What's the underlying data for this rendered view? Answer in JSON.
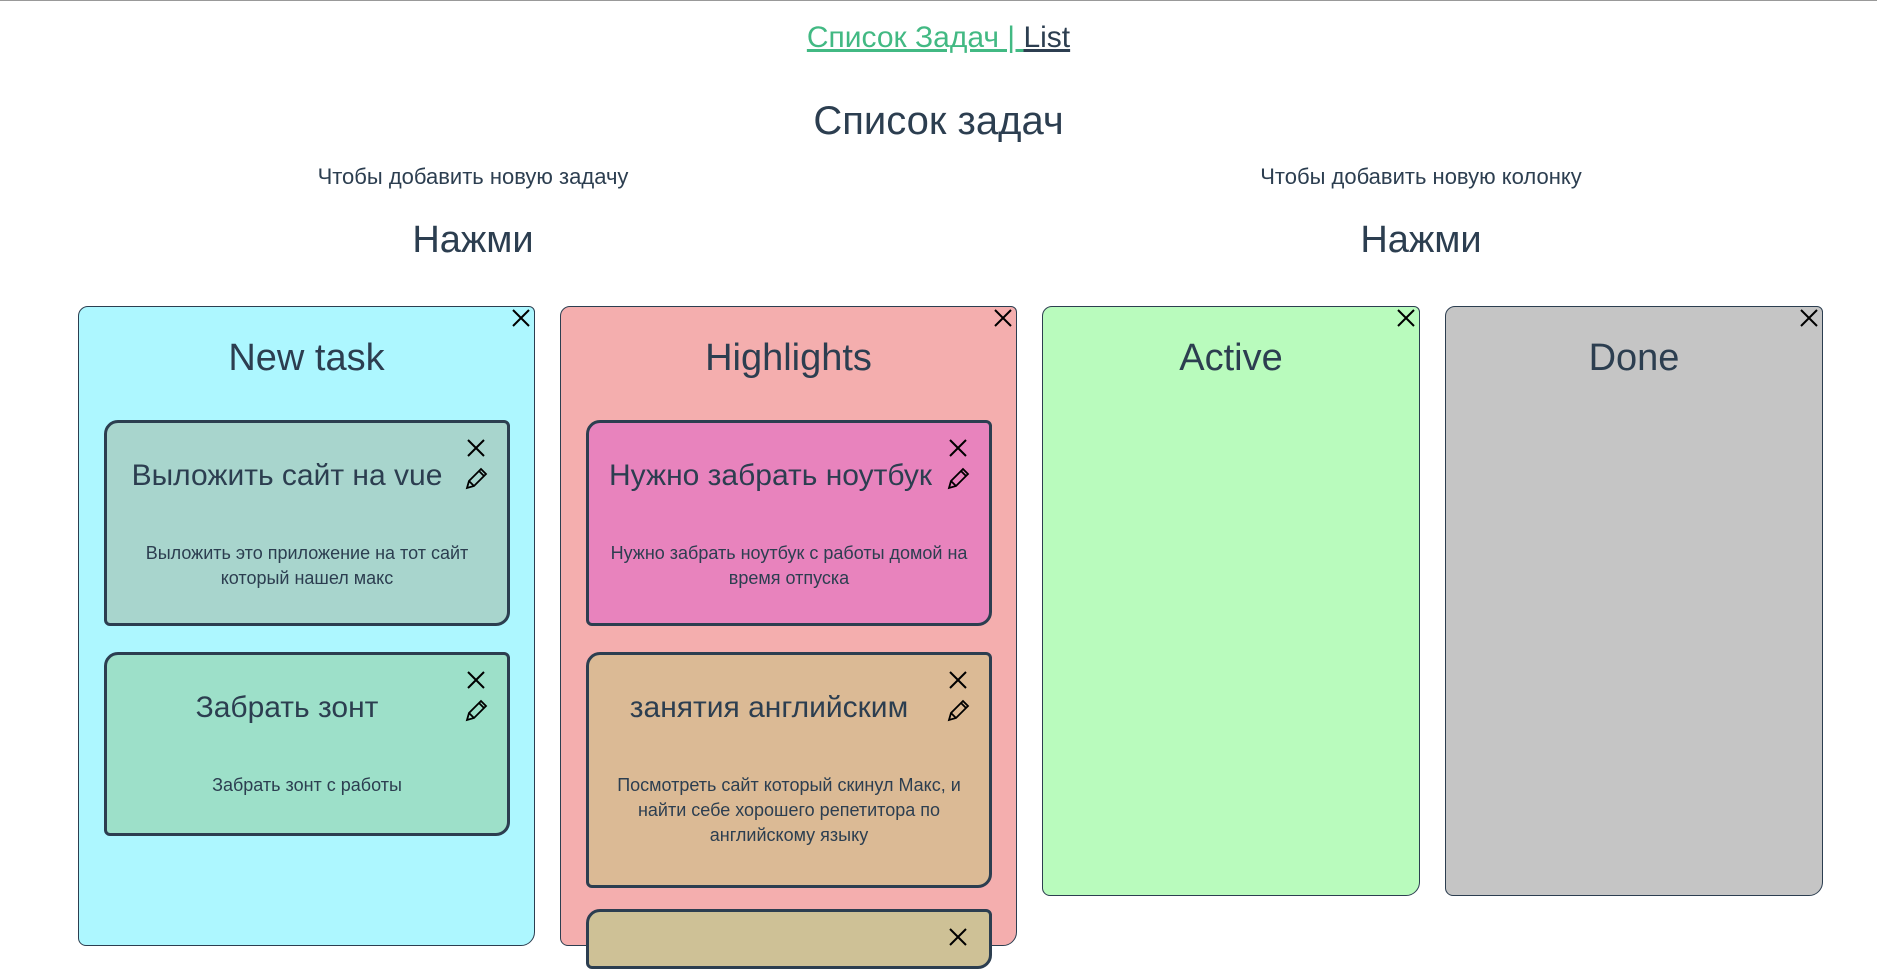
{
  "nav": {
    "link1": "Список Задач | ",
    "link2": "List"
  },
  "page_title": "Список задач",
  "add_task": {
    "hint": "Чтобы добавить новую задачу",
    "button": "Нажми"
  },
  "add_column": {
    "hint": "Чтобы добавить новую колонку",
    "button": "Нажми"
  },
  "columns": [
    {
      "title": "New task",
      "color": "#adf7ff",
      "cards": [
        {
          "title": "Выложить сайт на vue",
          "desc": "Выложить это приложение на тот сайт который нашел макс",
          "color": "#a8d5cd"
        },
        {
          "title": "Забрать зонт",
          "desc": "Забрать зонт с работы",
          "color": "#9de0c9"
        }
      ]
    },
    {
      "title": "Highlights",
      "color": "#f4aeae",
      "cards": [
        {
          "title": "Нужно забрать ноутбук",
          "desc": "Нужно забрать ноутбук с работы домой на время отпуска",
          "color": "#e883bd"
        },
        {
          "title": "занятия английским",
          "desc": "Посмотреть сайт который скинул Макс, и найти себе хорошего репетитора по английскому языку",
          "color": "#dbba95"
        },
        {
          "title": "",
          "desc": "",
          "color": "#cec196"
        }
      ]
    },
    {
      "title": "Active",
      "color": "#b9fbbd",
      "cards": []
    },
    {
      "title": "Done",
      "color": "#c5c5c5",
      "cards": []
    }
  ],
  "icons": {
    "close": "close-icon",
    "edit": "pencil-icon"
  }
}
